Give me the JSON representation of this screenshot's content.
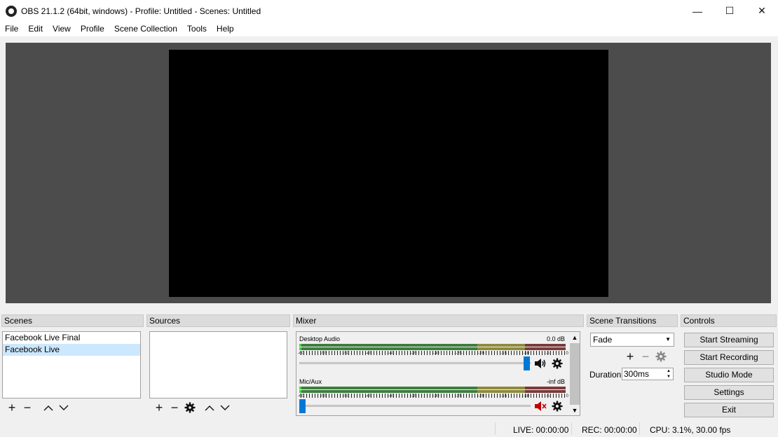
{
  "window": {
    "title": "OBS 21.1.2 (64bit, windows) - Profile: Untitled - Scenes: Untitled",
    "minimize": "—",
    "maximize": "☐",
    "close": "✕"
  },
  "menu": [
    "File",
    "Edit",
    "View",
    "Profile",
    "Scene Collection",
    "Tools",
    "Help"
  ],
  "docks": {
    "scenes": "Scenes",
    "sources": "Sources",
    "mixer": "Mixer",
    "transitions": "Scene Transitions",
    "controls": "Controls"
  },
  "scenes": {
    "items": [
      "Facebook Live Final",
      "Facebook Live"
    ],
    "selected_index": 1
  },
  "mixer": {
    "tracks": [
      {
        "name": "Desktop Audio",
        "db": "0.0 dB",
        "muted": false,
        "volume": 1.0
      },
      {
        "name": "Mic/Aux",
        "db": "-inf dB",
        "muted": true,
        "volume": 0.0
      }
    ],
    "tick_labels": [
      "-60",
      "-55",
      "-50",
      "-45",
      "-40",
      "-35",
      "-30",
      "-25",
      "-20",
      "-15",
      "-10",
      "-5",
      "0"
    ]
  },
  "transitions": {
    "selected": "Fade",
    "duration_label": "Duration",
    "duration_value": "300ms"
  },
  "controls": {
    "start_streaming": "Start Streaming",
    "start_recording": "Start Recording",
    "studio_mode": "Studio Mode",
    "settings": "Settings",
    "exit": "Exit"
  },
  "status": {
    "live": "LIVE: 00:00:00",
    "rec": "REC: 00:00:00",
    "cpu": "CPU: 3.1%, 30.00 fps"
  },
  "colors": {
    "preview_bg": "#4c4c4c",
    "selection": "#cce8ff",
    "slider": "#0078d7",
    "muted_icon": "#c00000"
  }
}
